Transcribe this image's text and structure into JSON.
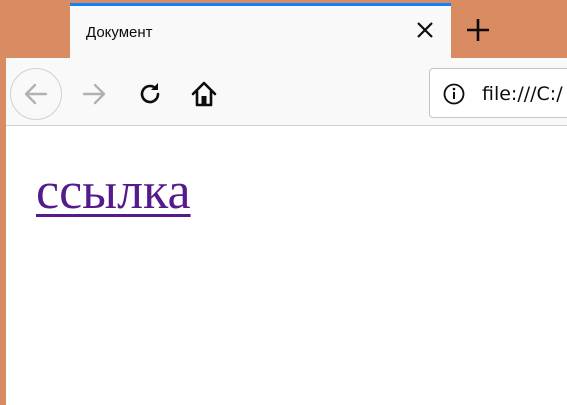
{
  "tab": {
    "title": "Документ",
    "active_color": "#0a84ff"
  },
  "toolbar": {
    "back_icon": "arrow-left-icon",
    "forward_icon": "arrow-right-icon",
    "reload_icon": "reload-icon",
    "home_icon": "home-icon"
  },
  "urlbar": {
    "info_icon": "info-icon",
    "url": "file:///C:/"
  },
  "content": {
    "link_text": "ссылка",
    "link_color": "#551a8b"
  },
  "colors": {
    "window_frame": "#d98b62",
    "toolbar_bg": "#f9f9fa",
    "page_bg": "#ffffff"
  }
}
